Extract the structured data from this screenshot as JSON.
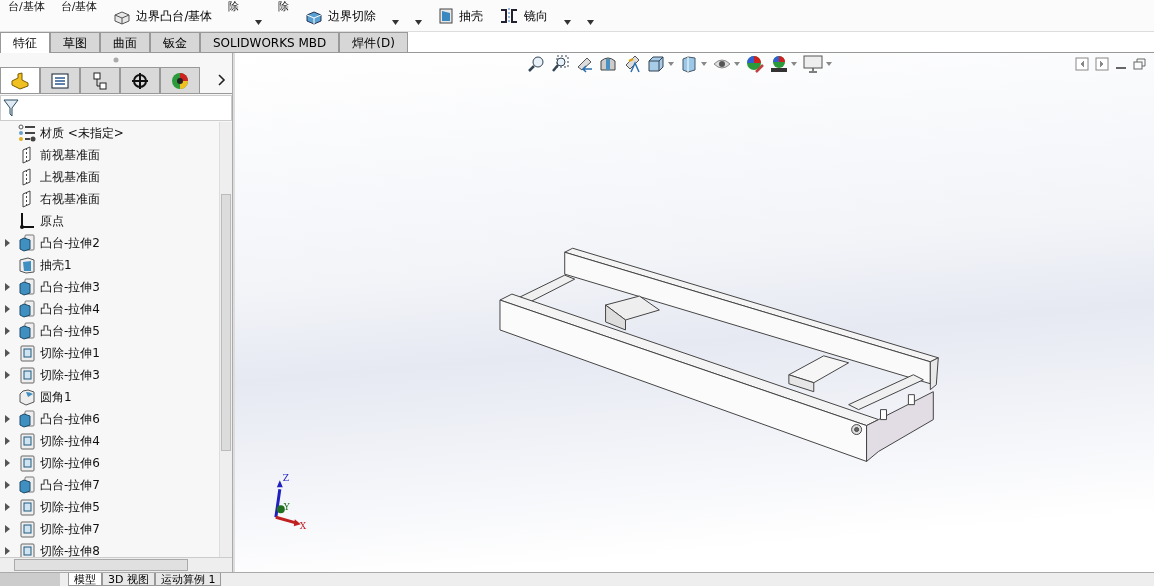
{
  "ribbon": {
    "items": [
      {
        "kind": "cut_text",
        "label": "台/基体"
      },
      {
        "kind": "cut_text",
        "label": "台/基体"
      },
      {
        "kind": "boss_button",
        "label": "边界凸台/基体"
      },
      {
        "kind": "cut_text",
        "label": "除"
      },
      {
        "kind": "caret"
      },
      {
        "kind": "cut_text",
        "label": "除"
      },
      {
        "kind": "cut_button",
        "label": "边界切除"
      },
      {
        "kind": "caret"
      },
      {
        "kind": "caret"
      },
      {
        "kind": "shell_button",
        "label": "抽壳"
      },
      {
        "kind": "mirror_button",
        "label": "镜向"
      },
      {
        "kind": "caret"
      },
      {
        "kind": "caret"
      }
    ]
  },
  "tabs": [
    {
      "label": "特征",
      "selected": true
    },
    {
      "label": "草图",
      "selected": false
    },
    {
      "label": "曲面",
      "selected": false
    },
    {
      "label": "钣金",
      "selected": false
    },
    {
      "label": "SOLIDWORKS MBD",
      "selected": false
    },
    {
      "label": "焊件(D)",
      "selected": false
    }
  ],
  "panel_tabs": [
    {
      "kind": "feature",
      "selected": true
    },
    {
      "kind": "property",
      "selected": false
    },
    {
      "kind": "config",
      "selected": false
    },
    {
      "kind": "dim",
      "selected": false
    },
    {
      "kind": "display",
      "selected": false
    }
  ],
  "tree": [
    {
      "kind": "material",
      "label": "材质 <未指定>",
      "collapsible": false
    },
    {
      "kind": "plane",
      "label": "前视基准面",
      "collapsible": false
    },
    {
      "kind": "plane",
      "label": "上视基准面",
      "collapsible": false
    },
    {
      "kind": "plane",
      "label": "右视基准面",
      "collapsible": false
    },
    {
      "kind": "origin",
      "label": "原点",
      "collapsible": false
    },
    {
      "kind": "boss",
      "label": "凸台-拉伸2",
      "collapsible": true
    },
    {
      "kind": "shell",
      "label": "抽壳1",
      "collapsible": false
    },
    {
      "kind": "boss",
      "label": "凸台-拉伸3",
      "collapsible": true
    },
    {
      "kind": "boss",
      "label": "凸台-拉伸4",
      "collapsible": true
    },
    {
      "kind": "boss",
      "label": "凸台-拉伸5",
      "collapsible": true
    },
    {
      "kind": "cut",
      "label": "切除-拉伸1",
      "collapsible": true
    },
    {
      "kind": "cut",
      "label": "切除-拉伸3",
      "collapsible": true
    },
    {
      "kind": "fillet",
      "label": "圆角1",
      "collapsible": false
    },
    {
      "kind": "boss",
      "label": "凸台-拉伸6",
      "collapsible": true
    },
    {
      "kind": "cut",
      "label": "切除-拉伸4",
      "collapsible": true
    },
    {
      "kind": "cut",
      "label": "切除-拉伸6",
      "collapsible": true
    },
    {
      "kind": "boss",
      "label": "凸台-拉伸7",
      "collapsible": true
    },
    {
      "kind": "cut",
      "label": "切除-拉伸5",
      "collapsible": true
    },
    {
      "kind": "cut",
      "label": "切除-拉伸7",
      "collapsible": true
    },
    {
      "kind": "cut",
      "label": "切除-拉伸8",
      "collapsible": true
    }
  ],
  "triad": {
    "x": "X",
    "y": "Y",
    "z": "Z"
  },
  "bottom_tabs": [
    {
      "label": "模型",
      "selected": true
    },
    {
      "label": "3D 视图",
      "selected": false
    },
    {
      "label": "运动算例 1",
      "selected": false
    }
  ]
}
